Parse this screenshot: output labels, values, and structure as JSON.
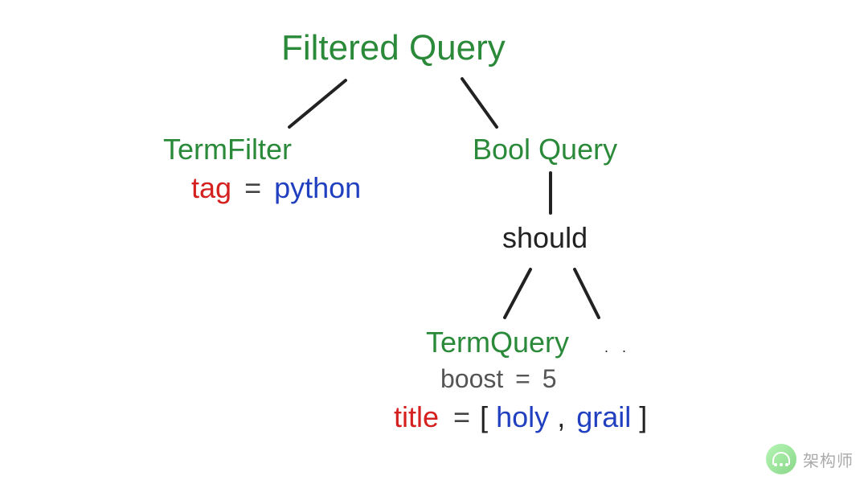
{
  "root": {
    "label": "Filtered Query"
  },
  "left": {
    "title": "TermFilter",
    "field": "tag",
    "equals": "=",
    "value": "python"
  },
  "right": {
    "title": "Bool Query",
    "clause": "should",
    "child": {
      "title": "TermQuery",
      "boost_key": "boost",
      "boost_eq": "=",
      "boost_val": "5",
      "field": "title",
      "equals": "=",
      "arr_open": "[",
      "val1": "holy",
      "comma": ",",
      "val2": "grail",
      "arr_close": "]"
    },
    "dots": ". ."
  },
  "watermark": {
    "text": "架构师"
  }
}
